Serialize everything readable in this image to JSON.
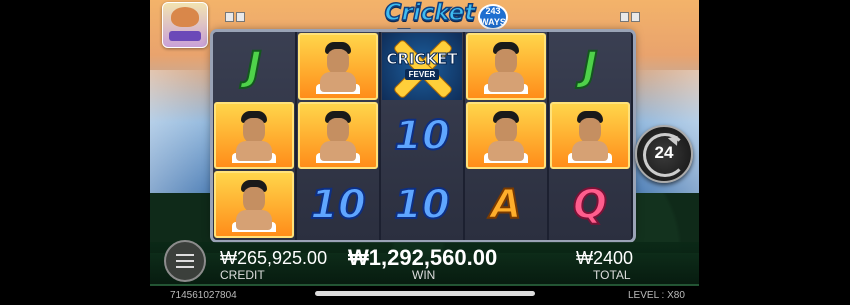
{
  "game": {
    "logo_title": "Cricket Fever",
    "logo_badge": "243",
    "logo_badge_sub": "WAYS"
  },
  "reels": [
    [
      "J",
      "player",
      "player"
    ],
    [
      "player",
      "player",
      "10"
    ],
    [
      "wild",
      "10",
      "10"
    ],
    [
      "player",
      "player",
      "A"
    ],
    [
      "J",
      "player",
      "Q"
    ]
  ],
  "wild_symbol": {
    "line1": "CRICKET",
    "line2": "FEVER"
  },
  "spin_button": {
    "count": "24"
  },
  "stats": {
    "credit_value": "₩265,925.00",
    "credit_label": "CREDIT",
    "win_value": "₩1,292,560.00",
    "win_label": "WIN",
    "total_value": "₩2400",
    "total_label": "TOTAL"
  },
  "footer": {
    "session_id": "714561027804",
    "level_text": "LEVEL : X80"
  },
  "colors": {
    "accent": "#3fbdf2",
    "board": "#1c2030"
  }
}
